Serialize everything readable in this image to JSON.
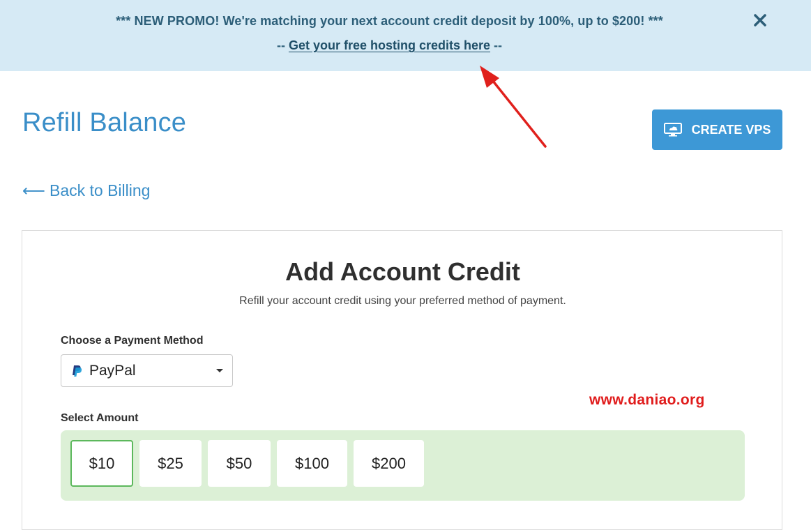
{
  "promo": {
    "line1": "*** NEW PROMO! We're matching your next account credit deposit by 100%, up to $200! ***",
    "line2_prefix": "-- ",
    "link_text": "Get your free hosting credits here",
    "line2_suffix": " --",
    "close_icon": "close-icon",
    "color": "#2c5e78",
    "background": "#d6eaf5"
  },
  "header": {
    "title": "Refill Balance",
    "create_vps_label": "CREATE VPS",
    "create_vps_icon": "monitor-cloud-icon",
    "accent": "#3d98d6"
  },
  "back_link": {
    "arrow": "⟵",
    "label": "Back to Billing"
  },
  "card": {
    "title": "Add Account Credit",
    "subtitle": "Refill your account credit using your preferred method of payment.",
    "payment_method_label": "Choose a Payment Method",
    "payment_method_selected": "PayPal",
    "payment_method_icon": "paypal-icon",
    "amount_label": "Select Amount",
    "amounts": [
      "$10",
      "$25",
      "$50",
      "$100",
      "$200"
    ],
    "selected_amount": "$10"
  },
  "watermark": "www.daniao.org"
}
